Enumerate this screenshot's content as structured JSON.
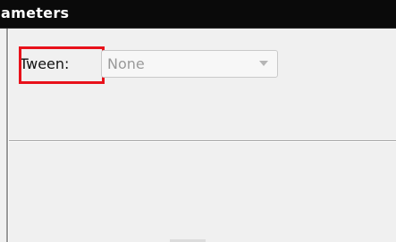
{
  "window": {
    "title": "ameters"
  },
  "parameters": {
    "tween_label": "Tween:",
    "tween_value": "None"
  },
  "colors": {
    "titlebar_bg": "#0a0a0a",
    "panel_bg": "#f0f0f0",
    "highlight": "#e8111a",
    "disabled_text": "#9a9a9a"
  },
  "icons": {
    "dropdown": "chevron-down-icon"
  }
}
